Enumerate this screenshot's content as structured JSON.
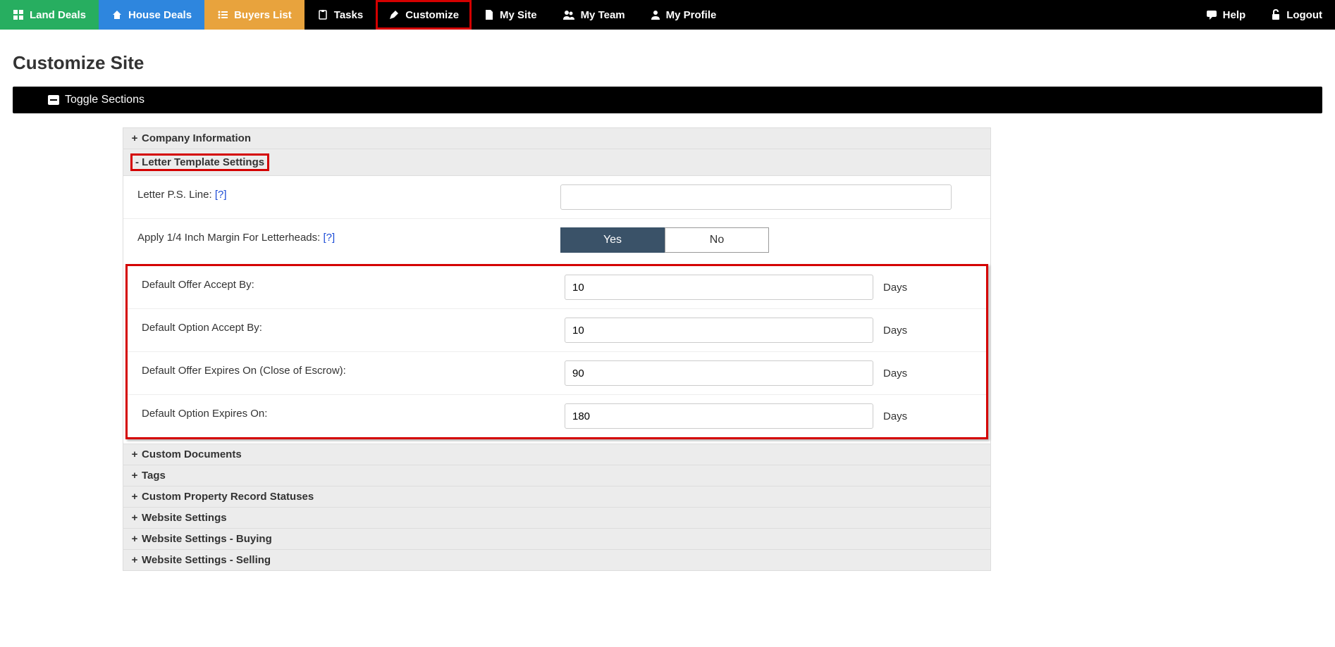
{
  "nav": {
    "land_deals": "Land Deals",
    "house_deals": "House Deals",
    "buyers_list": "Buyers List",
    "tasks": "Tasks",
    "customize": "Customize",
    "my_site": "My Site",
    "my_team": "My Team",
    "my_profile": "My Profile",
    "help": "Help",
    "logout": "Logout"
  },
  "page_title": "Customize Site",
  "toggle_bar": "Toggle Sections",
  "sections": {
    "company_info": "Company Information",
    "letter_template": "Letter Template Settings",
    "custom_documents": "Custom Documents",
    "tags": "Tags",
    "custom_statuses": "Custom Property Record Statuses",
    "website_settings": "Website Settings",
    "website_buying": "Website Settings - Buying",
    "website_selling": "Website Settings - Selling"
  },
  "form": {
    "ps_line_label": "Letter P.S. Line:",
    "ps_line_help": "[?]",
    "ps_line_value": "",
    "margin_label": "Apply 1/4 Inch Margin For Letterheads:",
    "margin_help": "[?]",
    "margin_yes": "Yes",
    "margin_no": "No",
    "offer_accept_label": "Default Offer Accept By:",
    "offer_accept_value": "10",
    "option_accept_label": "Default Option Accept By:",
    "option_accept_value": "10",
    "offer_expires_label": "Default Offer Expires On (Close of Escrow):",
    "offer_expires_value": "90",
    "option_expires_label": "Default Option Expires On:",
    "option_expires_value": "180",
    "days_suffix": "Days"
  },
  "symbols": {
    "plus": "+",
    "minus": "-",
    "minus_hl": "- "
  }
}
